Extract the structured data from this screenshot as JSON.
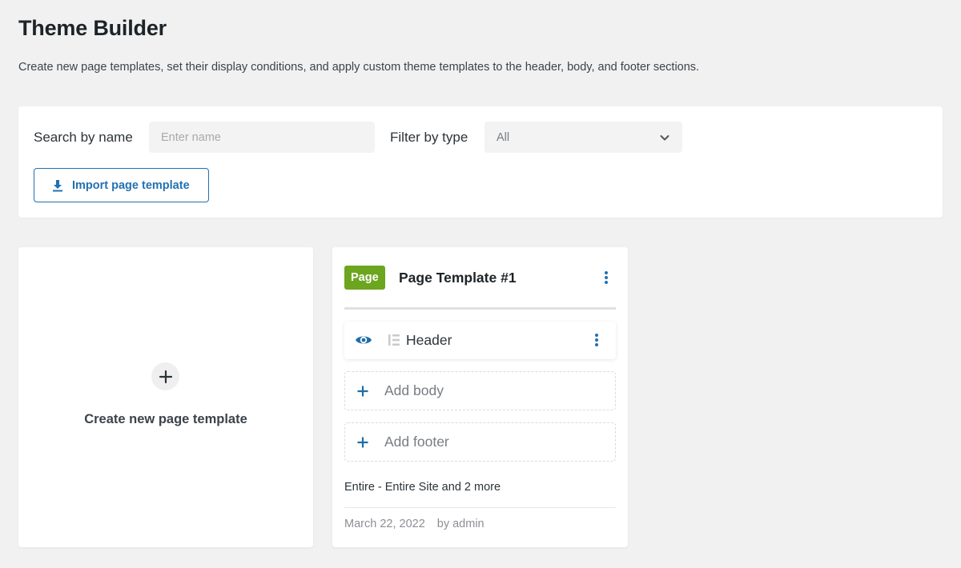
{
  "header": {
    "title": "Theme Builder",
    "description": "Create new page templates, set their display conditions, and apply custom theme templates to the header, body, and footer sections."
  },
  "filters": {
    "search_label": "Search by name",
    "search_placeholder": "Enter name",
    "search_value": "",
    "type_label": "Filter by type",
    "type_selected": "All",
    "import_button": "Import page template",
    "import_icon": "download-icon"
  },
  "create_card": {
    "label": "Create new page template",
    "icon": "plus-icon"
  },
  "templates": [
    {
      "type_badge": "Page",
      "title": "Page Template #1",
      "sections": [
        {
          "label": "Header",
          "assigned": true,
          "visible": true
        }
      ],
      "add_actions": [
        {
          "label": "Add body"
        },
        {
          "label": "Add footer"
        }
      ],
      "conditions": "Entire - Entire Site and 2 more",
      "date": "March 22, 2022",
      "author": "by admin"
    }
  ],
  "colors": {
    "accent": "#2271b1",
    "badge_page": "#6ca51e",
    "background": "#f1f1f1"
  }
}
